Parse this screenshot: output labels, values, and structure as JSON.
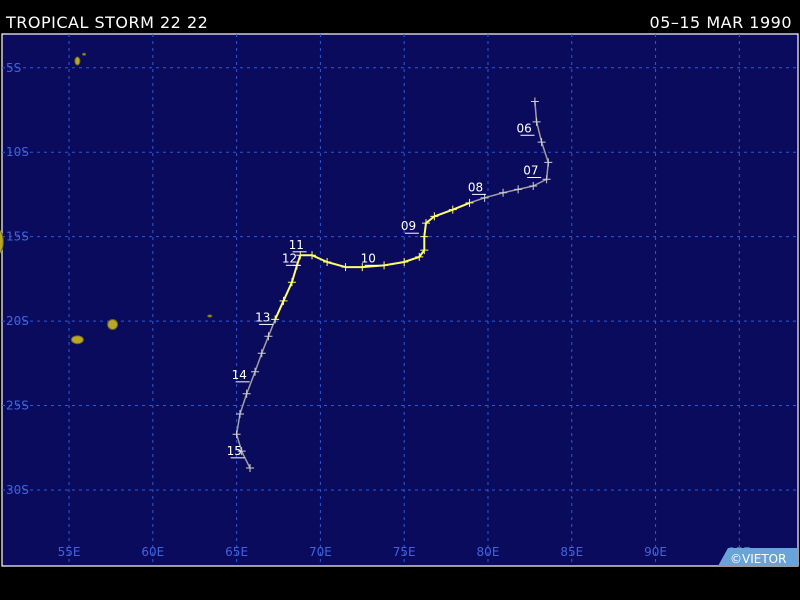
{
  "header": {
    "storm_name": "TROPICAL STORM 22 22",
    "date_range": "05–15 MAR 1990"
  },
  "credit": "©VIETOR",
  "colors": {
    "ocean": "#0b0b5e",
    "grid": "#2a5bd6",
    "label": "#3f64e0",
    "land": "#b8a82a",
    "track_storm": "#ffff66",
    "track_weak": "#a0a0a0"
  },
  "map": {
    "lon_range": [
      51,
      98.5
    ],
    "lat_range": [
      -3,
      -34.5
    ],
    "lon_ticks": [
      {
        "value": 55,
        "label": "55E"
      },
      {
        "value": 60,
        "label": "60E"
      },
      {
        "value": 65,
        "label": "65E"
      },
      {
        "value": 70,
        "label": "70E"
      },
      {
        "value": 75,
        "label": "75E"
      },
      {
        "value": 80,
        "label": "80E"
      },
      {
        "value": 85,
        "label": "85E"
      },
      {
        "value": 90,
        "label": "90E"
      },
      {
        "value": 95,
        "label": "95E"
      }
    ],
    "lat_ticks": [
      {
        "value": -5,
        "label": "5S"
      },
      {
        "value": -10,
        "label": "10S"
      },
      {
        "value": -15,
        "label": "15S"
      },
      {
        "value": -20,
        "label": "20S"
      },
      {
        "value": -25,
        "label": "25S"
      },
      {
        "value": -30,
        "label": "30S"
      }
    ]
  },
  "track": [
    {
      "lon": 82.8,
      "lat": -7.0,
      "intensity": "weak"
    },
    {
      "lon": 82.9,
      "lat": -8.2,
      "intensity": "weak"
    },
    {
      "lon": 83.2,
      "lat": -9.4,
      "intensity": "weak"
    },
    {
      "lon": 83.6,
      "lat": -10.6,
      "intensity": "weak"
    },
    {
      "lon": 83.5,
      "lat": -11.6,
      "intensity": "weak"
    },
    {
      "lon": 82.7,
      "lat": -12.0,
      "intensity": "weak"
    },
    {
      "lon": 81.8,
      "lat": -12.2,
      "intensity": "weak"
    },
    {
      "lon": 80.9,
      "lat": -12.4,
      "intensity": "weak"
    },
    {
      "lon": 79.8,
      "lat": -12.7,
      "intensity": "weak"
    },
    {
      "lon": 78.9,
      "lat": -13.0,
      "intensity": "storm"
    },
    {
      "lon": 77.9,
      "lat": -13.4,
      "intensity": "storm"
    },
    {
      "lon": 76.8,
      "lat": -13.8,
      "intensity": "storm"
    },
    {
      "lon": 76.3,
      "lat": -14.2,
      "intensity": "storm"
    },
    {
      "lon": 76.2,
      "lat": -15.0,
      "intensity": "storm"
    },
    {
      "lon": 76.2,
      "lat": -15.8,
      "intensity": "storm"
    },
    {
      "lon": 75.9,
      "lat": -16.2,
      "intensity": "storm"
    },
    {
      "lon": 75.0,
      "lat": -16.5,
      "intensity": "storm"
    },
    {
      "lon": 73.8,
      "lat": -16.7,
      "intensity": "storm"
    },
    {
      "lon": 72.5,
      "lat": -16.8,
      "intensity": "storm"
    },
    {
      "lon": 71.5,
      "lat": -16.8,
      "intensity": "storm"
    },
    {
      "lon": 70.4,
      "lat": -16.5,
      "intensity": "storm"
    },
    {
      "lon": 69.5,
      "lat": -16.1,
      "intensity": "storm"
    },
    {
      "lon": 68.8,
      "lat": -16.1,
      "intensity": "storm"
    },
    {
      "lon": 68.6,
      "lat": -16.7,
      "intensity": "storm"
    },
    {
      "lon": 68.3,
      "lat": -17.7,
      "intensity": "storm"
    },
    {
      "lon": 67.8,
      "lat": -18.8,
      "intensity": "storm"
    },
    {
      "lon": 67.3,
      "lat": -19.9,
      "intensity": "storm"
    },
    {
      "lon": 66.9,
      "lat": -20.9,
      "intensity": "weak"
    },
    {
      "lon": 66.5,
      "lat": -21.9,
      "intensity": "weak"
    },
    {
      "lon": 66.1,
      "lat": -23.0,
      "intensity": "weak"
    },
    {
      "lon": 65.6,
      "lat": -24.3,
      "intensity": "weak"
    },
    {
      "lon": 65.2,
      "lat": -25.5,
      "intensity": "weak"
    },
    {
      "lon": 65.0,
      "lat": -26.7,
      "intensity": "weak"
    },
    {
      "lon": 65.3,
      "lat": -27.7,
      "intensity": "weak"
    },
    {
      "lon": 65.8,
      "lat": -28.7,
      "intensity": "weak"
    }
  ],
  "day_labels": [
    {
      "label": "06",
      "lon": 82.3,
      "lat": -8.7
    },
    {
      "label": "07",
      "lon": 82.7,
      "lat": -11.2
    },
    {
      "label": "08",
      "lon": 79.4,
      "lat": -12.2
    },
    {
      "label": "09",
      "lon": 75.4,
      "lat": -14.5
    },
    {
      "label": "10",
      "lon": 73.0,
      "lat": -16.4
    },
    {
      "label": "11",
      "lon": 68.7,
      "lat": -15.6
    },
    {
      "label": "12",
      "lon": 68.3,
      "lat": -16.4
    },
    {
      "label": "13",
      "lon": 66.7,
      "lat": -19.9
    },
    {
      "label": "14",
      "lon": 65.3,
      "lat": -23.3
    },
    {
      "label": "15",
      "lon": 65.0,
      "lat": -27.8
    }
  ],
  "land": [
    {
      "name": "Tromelin",
      "lon": 55.5,
      "lat": -4.6
    },
    {
      "name": "Seychelles outer",
      "lon": 55.9,
      "lat": -4.2
    },
    {
      "name": "Reunion",
      "lon": 55.5,
      "lat": -21.1
    },
    {
      "name": "Mauritius",
      "lon": 57.6,
      "lat": -20.2
    },
    {
      "name": "Rodrigues",
      "lon": 63.4,
      "lat": -19.7
    },
    {
      "name": "Madagascar",
      "lon": 50.6,
      "lat": -15.3
    }
  ]
}
